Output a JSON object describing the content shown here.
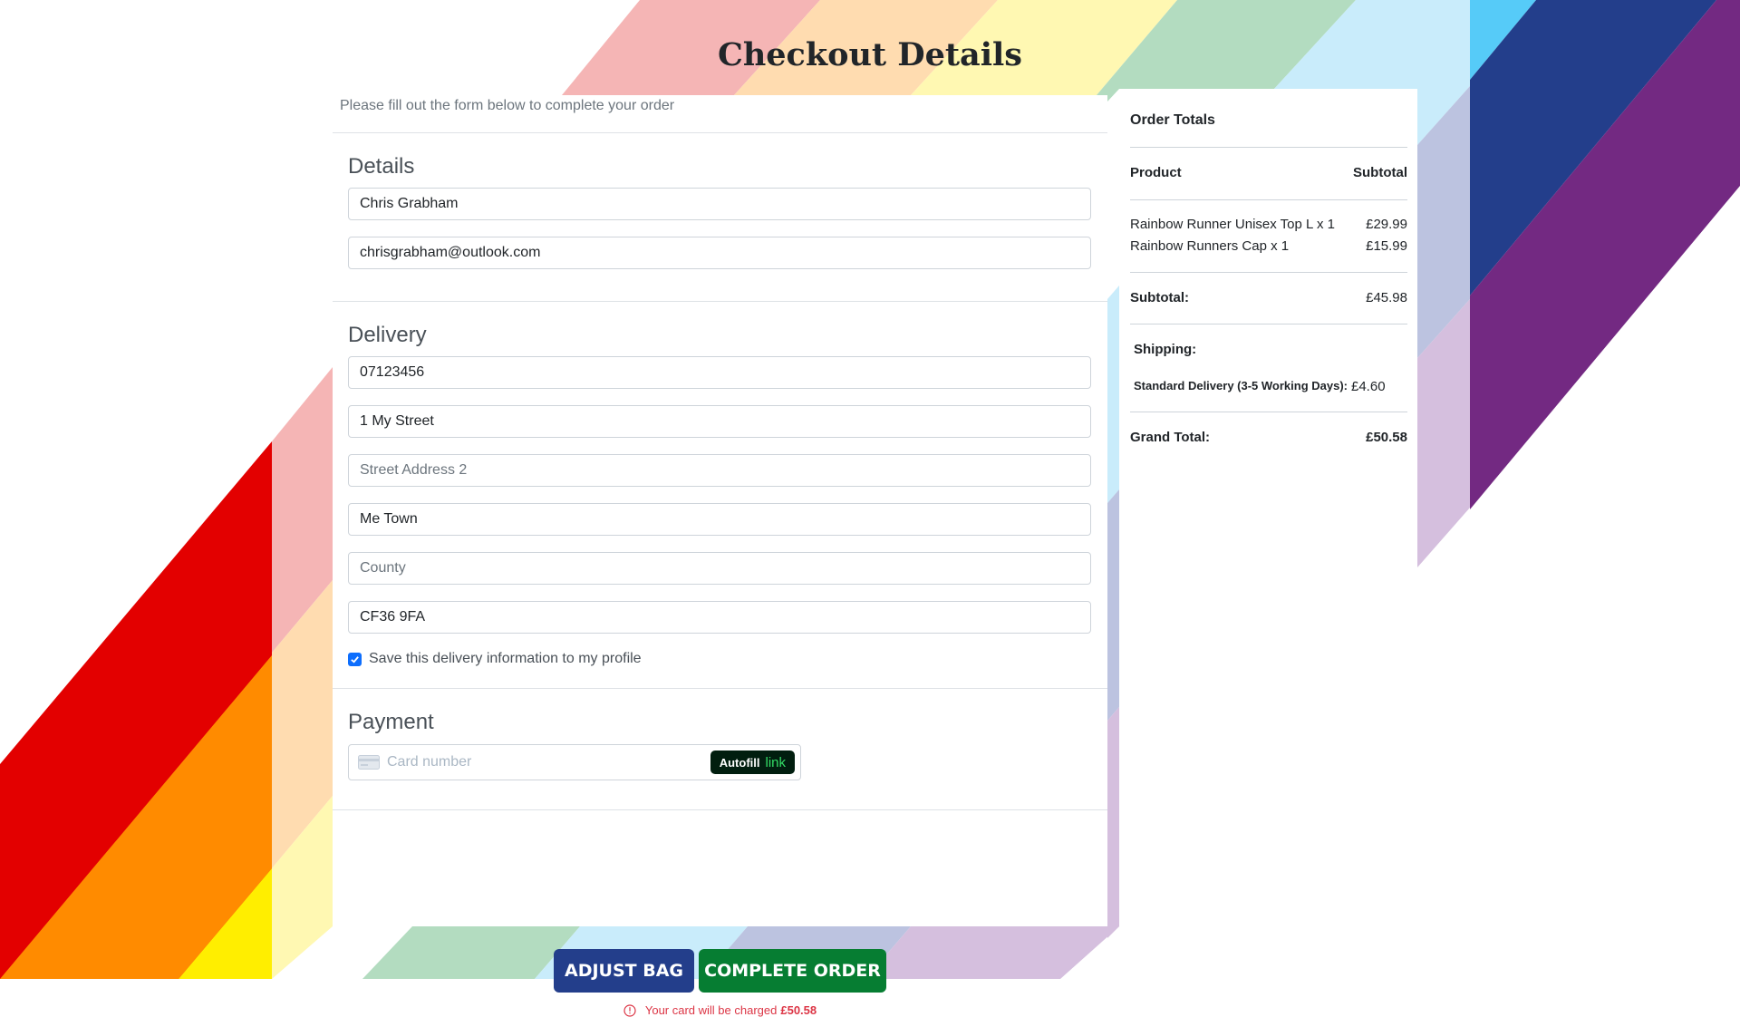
{
  "page": {
    "title": "Checkout Details",
    "subtitle": "Please fill out the form below to complete your order"
  },
  "details": {
    "heading": "Details",
    "full_name": "Chris Grabham",
    "email": "chrisgrabham@outlook.com"
  },
  "delivery": {
    "heading": "Delivery",
    "phone": "07123456",
    "street1": "1 My Street",
    "street2_placeholder": "Street Address 2",
    "town": "Me Town",
    "county_placeholder": "County",
    "postcode": "CF36 9FA",
    "save_label": "Save this delivery information to my profile",
    "save_checked": true
  },
  "payment": {
    "heading": "Payment",
    "card_placeholder": "Card number",
    "autofill_label": "Autofill",
    "autofill_link": "link"
  },
  "actions": {
    "adjust_bag": "ADJUST BAG",
    "complete_order": "COMPLETE ORDER",
    "charge_note": "Your card will be charged",
    "charge_amount": "£50.58"
  },
  "order_totals": {
    "title": "Order Totals",
    "col_product": "Product",
    "col_subtotal": "Subtotal",
    "items": [
      {
        "name": "Rainbow Runner Unisex Top L x 1",
        "price": "£29.99"
      },
      {
        "name": "Rainbow Runners Cap x 1",
        "price": "£15.99"
      }
    ],
    "subtotal_label": "Subtotal:",
    "subtotal_value": "£45.98",
    "shipping_label": "Shipping:",
    "shipping_method": "Standard Delivery (3-5 Working Days):",
    "shipping_value": "£4.60",
    "grand_total_label": "Grand Total:",
    "grand_total_value": "£50.58"
  },
  "colors": {
    "primary_button": "#233e8b",
    "success_button": "#067d32",
    "checkbox": "#0d6efd",
    "danger_text": "#dc3545"
  }
}
